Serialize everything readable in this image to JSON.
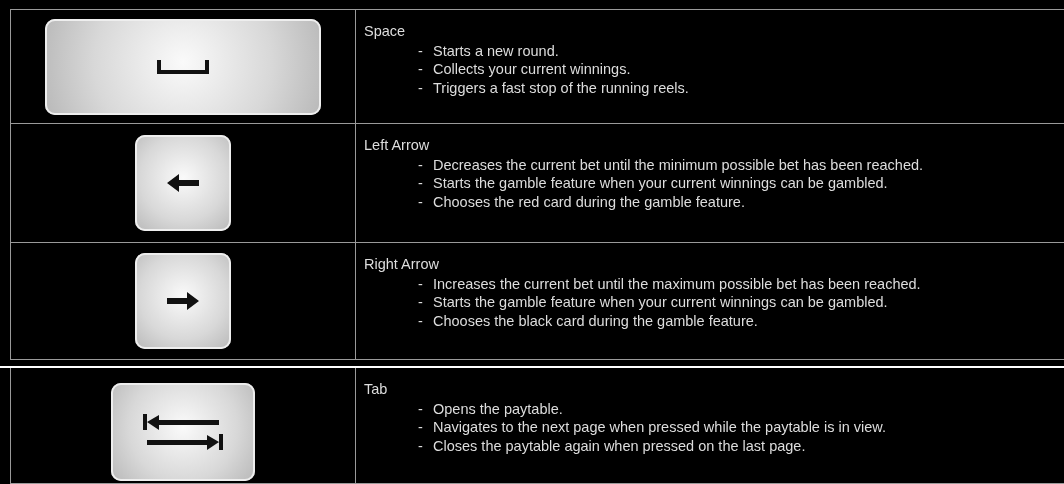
{
  "keys": [
    {
      "kind": "space",
      "name": "Space",
      "items": [
        {
          "bullet": "-",
          "text": "Starts a new round."
        },
        {
          "bullet": "-",
          "text": "Collects your current winnings."
        },
        {
          "bullet": "-",
          "text": "Triggers a fast stop of the running reels."
        }
      ]
    },
    {
      "kind": "left",
      "name": "Left Arrow",
      "items": [
        {
          "bullet": "-",
          "text": "Decreases the current bet until the minimum possible bet has been reached."
        },
        {
          "bullet": "-",
          "text": "Starts the gamble feature when your current winnings can be gambled."
        },
        {
          "bullet": "-",
          "text": "Chooses the red card during the gamble feature."
        }
      ]
    },
    {
      "kind": "right",
      "name": "Right Arrow",
      "items": [
        {
          "bullet": "-",
          "text": "Increases the current bet until the maximum possible bet has been reached."
        },
        {
          "bullet": "-",
          "text": "Starts the gamble feature when your current winnings can be gambled."
        },
        {
          "bullet": "-",
          "text": "Chooses the black card during the gamble feature."
        }
      ]
    },
    {
      "kind": "tab",
      "name": "Tab",
      "items": [
        {
          "bullet": "-",
          "text": "Opens the paytable."
        },
        {
          "bullet": "-",
          "text": "Navigates to the next page when pressed while the paytable is in view."
        },
        {
          "bullet": "-",
          "text": "Closes the paytable again when pressed on the last page."
        }
      ]
    }
  ]
}
